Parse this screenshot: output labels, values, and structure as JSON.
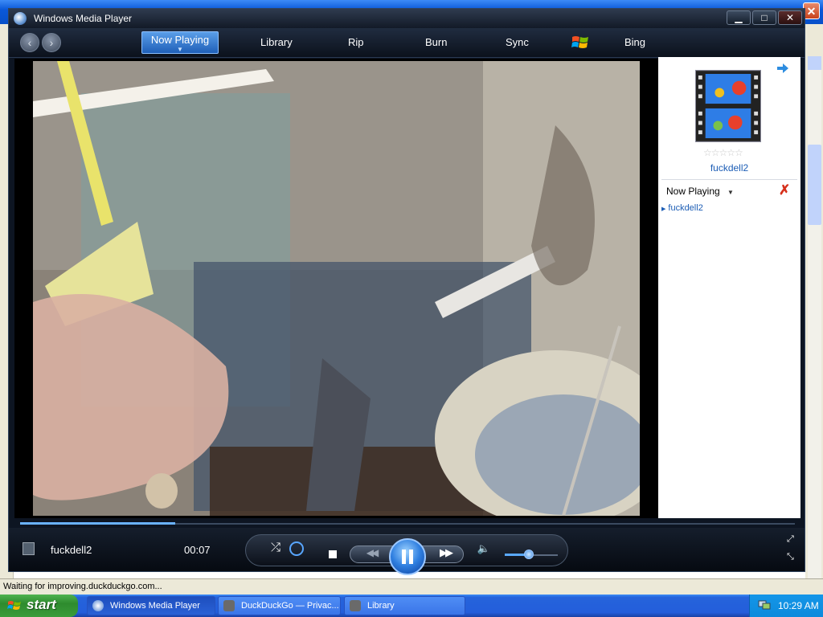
{
  "browser": {
    "status_text": "Waiting for improving.duckduckgo.com..."
  },
  "wmp": {
    "title": "Windows Media Player",
    "window_buttons": {
      "minimize": "▁",
      "maximize": "□",
      "close": "✕"
    },
    "nav": {
      "back_icon": "back-arrow-icon",
      "forward_icon": "forward-arrow-icon",
      "tabs": [
        {
          "label": "Now Playing",
          "active": true
        },
        {
          "label": "Library",
          "active": false
        },
        {
          "label": "Rip",
          "active": false
        },
        {
          "label": "Burn",
          "active": false
        },
        {
          "label": "Sync",
          "active": false
        },
        {
          "label": "Bing",
          "active": false
        }
      ]
    },
    "side_panel": {
      "album_title": "fuckdell2",
      "rating": "☆☆☆☆☆",
      "playlist_label": "Now Playing",
      "playlist_items": [
        "fuckdell2"
      ]
    },
    "playback": {
      "media_title": "fuckdell2",
      "time": "00:07",
      "progress_fraction": 0.2,
      "volume_fraction": 0.45,
      "state": "playing"
    },
    "colors": {
      "accent": "#2f7fe0",
      "link": "#1c5db5",
      "clear": "#d6301b"
    }
  },
  "taskbar": {
    "start_label": "start",
    "tasks": [
      {
        "label": "Windows Media Player",
        "icon": "wmp-icon",
        "active": true
      },
      {
        "label": "DuckDuckGo — Privac...",
        "icon": "raccoon-icon",
        "active": false
      },
      {
        "label": "Library",
        "icon": "raccoon-icon",
        "active": false
      }
    ],
    "clock": "10:29 AM"
  }
}
